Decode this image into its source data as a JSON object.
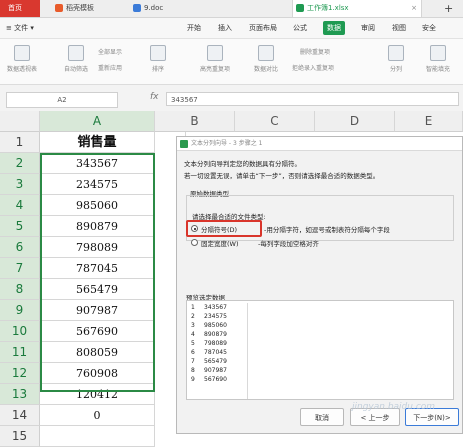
{
  "tabs": [
    {
      "label": "首页",
      "color": "#d9382f"
    },
    {
      "label": "稻壳模板",
      "color": "#e85b2b"
    },
    {
      "label": "9.doc",
      "color": "#3b7bd8"
    },
    {
      "label": "工作簿1.xlsx",
      "color": "#1f9a52"
    }
  ],
  "menu": {
    "file": "≡ 文件 ▾",
    "items": [
      "开始",
      "插入",
      "页面布局",
      "公式",
      "数据",
      "审阅",
      "视图",
      "安全"
    ],
    "active_index": 4
  },
  "ribbon": {
    "buttons": [
      "数据透视表",
      "自动筛选",
      "全部显示",
      "重新应用",
      "排序",
      "高亮重复项",
      "数据对比",
      "拒绝录入重复项",
      "删除重复项",
      "分列",
      "智能填充"
    ]
  },
  "formula_bar": {
    "cell_ref": "A2",
    "fx": "fx",
    "value": "343567"
  },
  "sheet": {
    "columns": [
      "A",
      "B",
      "C",
      "D",
      "E"
    ],
    "rows": [
      "1",
      "2",
      "3",
      "4",
      "5",
      "6",
      "7",
      "8",
      "9",
      "10",
      "11",
      "12",
      "13",
      "14",
      "15"
    ],
    "cells": [
      "销售量",
      "343567",
      "234575",
      "985060",
      "890879",
      "798089",
      "787045",
      "565479",
      "907987",
      "567690",
      "808059",
      "760908",
      "120412",
      "0",
      ""
    ]
  },
  "dialog": {
    "title": "文本分列向导 - 3 步骤之 1",
    "line1": "文本分列向导判定您的数据具有分隔符。",
    "line2": "若一切设置无误，请单击“下一步”，否则请选择最合适的数据类型。",
    "section": "原始数据类型",
    "prompt": "请选择最合适的文件类型:",
    "option1": "分隔符号(D)",
    "option1_desc": "-用分隔字符，如逗号或制表符分隔每个字段",
    "option2": "固定宽度(W)",
    "option2_desc": "-每列字段加空格对齐",
    "preview_label": "预览选定数据",
    "preview_rows": [
      {
        "n": "1",
        "v": "343567"
      },
      {
        "n": "2",
        "v": "234575"
      },
      {
        "n": "3",
        "v": "985060"
      },
      {
        "n": "4",
        "v": "890879"
      },
      {
        "n": "5",
        "v": "798089"
      },
      {
        "n": "6",
        "v": "787045"
      },
      {
        "n": "7",
        "v": "565479"
      },
      {
        "n": "8",
        "v": "907987"
      },
      {
        "n": "9",
        "v": "567690"
      }
    ],
    "cancel": "取消",
    "back": "< 上一步",
    "next": "下一步(N)>"
  },
  "watermark": "jingyan.baidu.com"
}
